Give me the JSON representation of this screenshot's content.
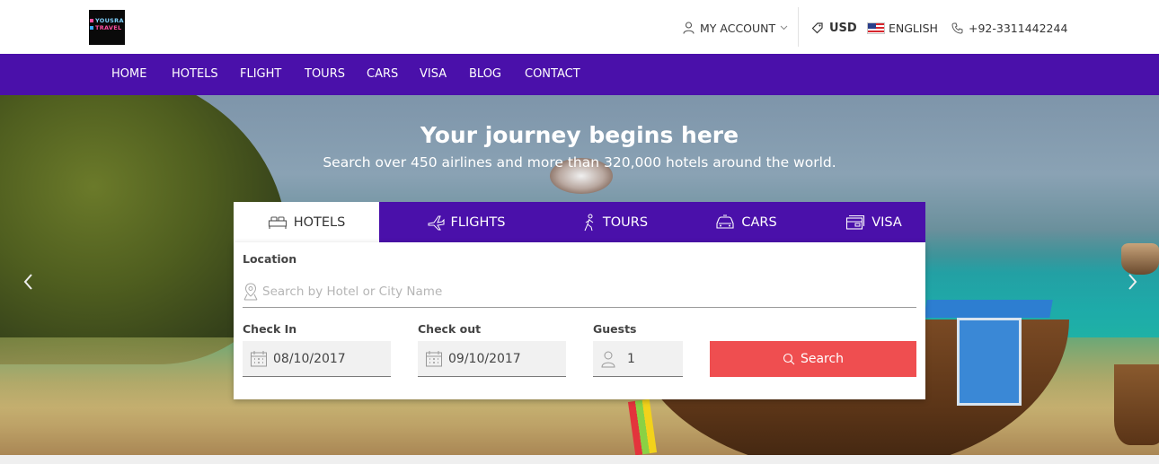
{
  "logo": {
    "line1": "YOUSRA",
    "line2": "TRAVEL"
  },
  "topbar": {
    "account_label": "MY ACCOUNT",
    "currency": "USD",
    "language": "ENGLISH",
    "phone": "+92-3311442244"
  },
  "nav": {
    "items": [
      "HOME",
      "HOTELS",
      "FLIGHT",
      "TOURS",
      "CARS",
      "VISA",
      "BLOG",
      "CONTACT"
    ]
  },
  "hero": {
    "title": "Your journey begins here",
    "subtitle": "Search over 450 airlines and more than 320,000 hotels around the world."
  },
  "search": {
    "tabs": [
      {
        "label": "HOTELS",
        "icon": "bed-icon",
        "active": true
      },
      {
        "label": "FLIGHTS",
        "icon": "plane-icon",
        "active": false
      },
      {
        "label": "TOURS",
        "icon": "walker-icon",
        "active": false
      },
      {
        "label": "CARS",
        "icon": "car-icon",
        "active": false
      },
      {
        "label": "VISA",
        "icon": "card-icon",
        "active": false
      }
    ],
    "location_label": "Location",
    "location_placeholder": "Search by Hotel or City Name",
    "checkin_label": "Check In",
    "checkin_value": "08/10/2017",
    "checkout_label": "Check out",
    "checkout_value": "09/10/2017",
    "guests_label": "Guests",
    "guests_value": "1",
    "button_label": "Search"
  },
  "colors": {
    "brand_purple": "#4a10aa",
    "search_red": "#ef4e50"
  }
}
